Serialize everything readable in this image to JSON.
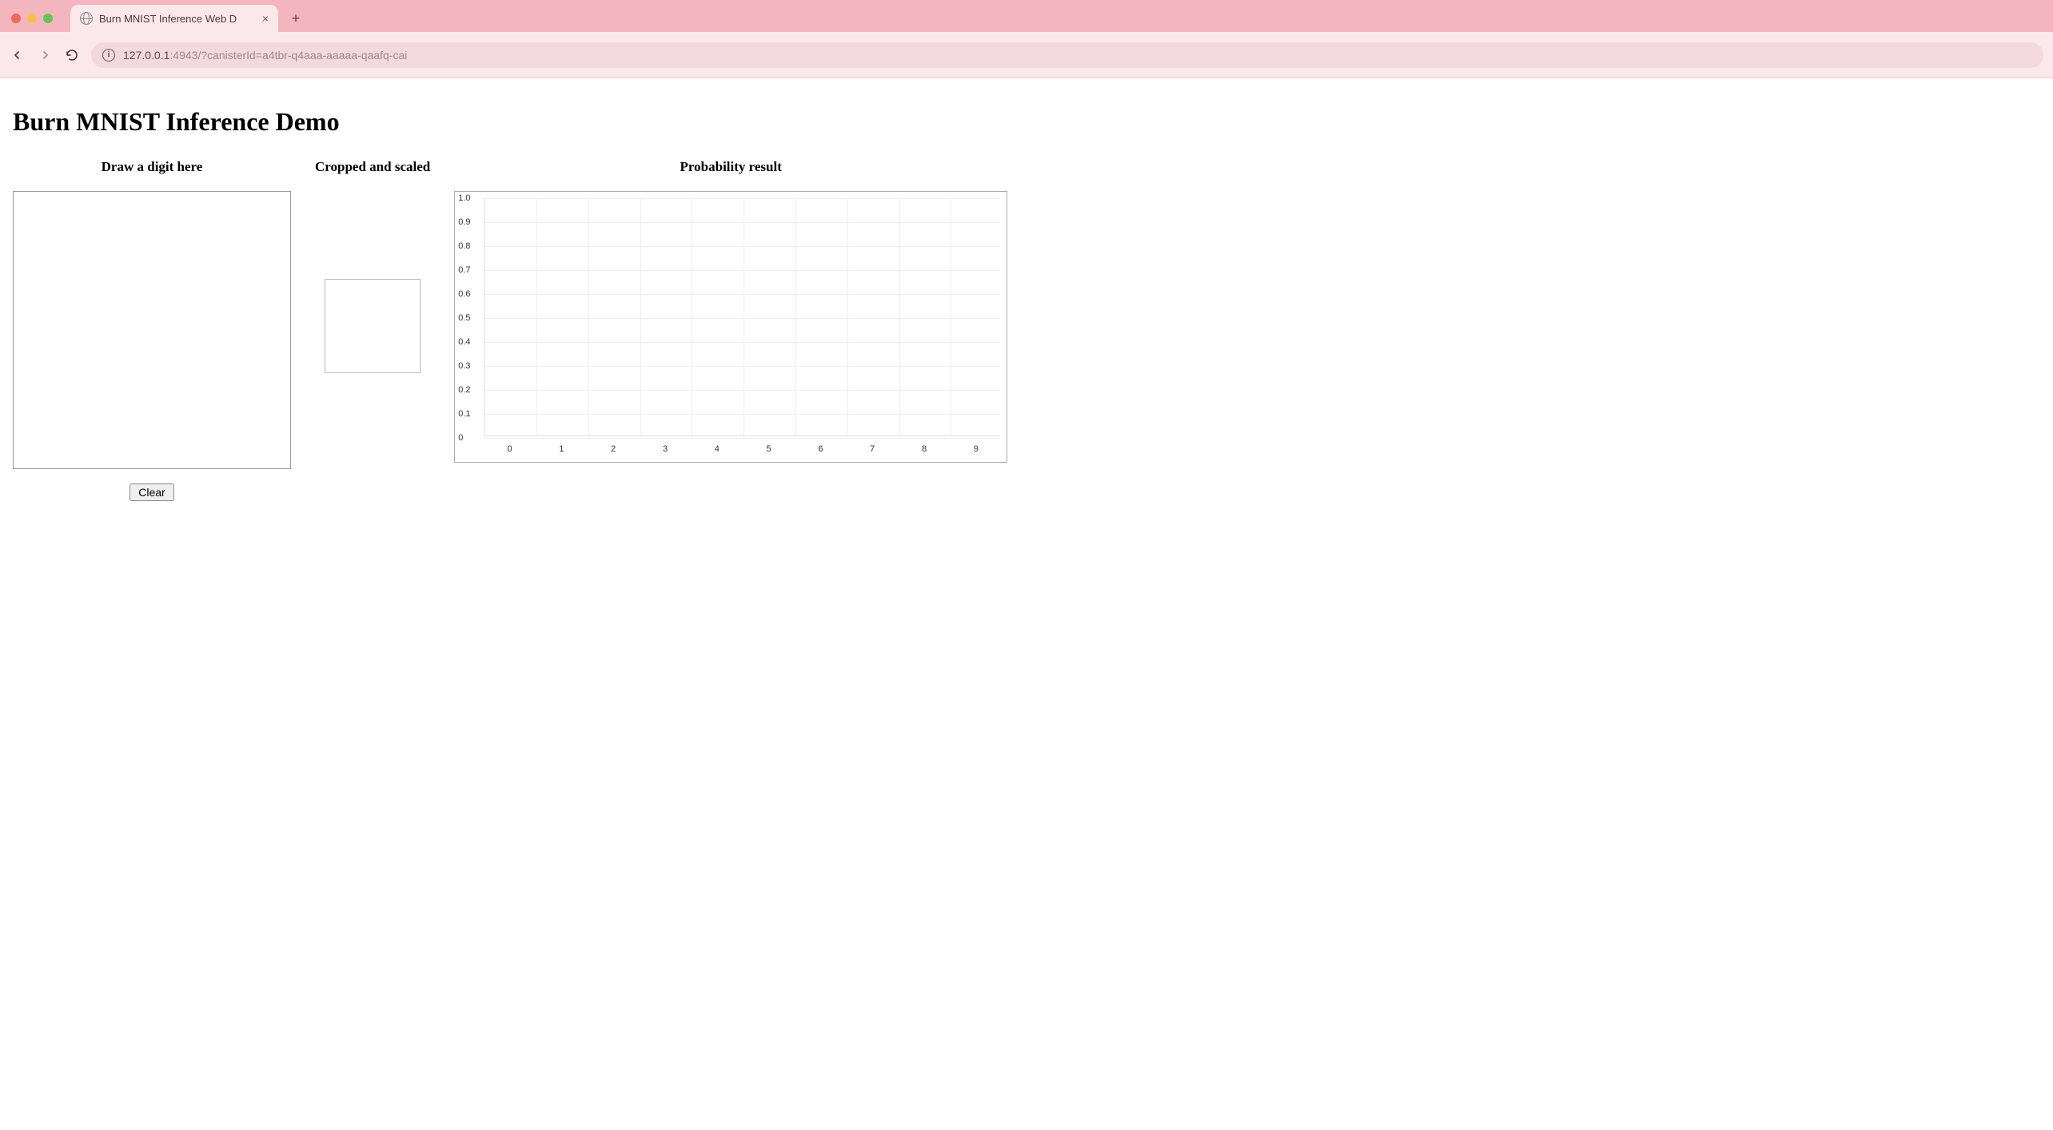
{
  "browser": {
    "tab_title": "Burn MNIST Inference Web D",
    "url_host": "127.0.0.1",
    "url_port": ":4943",
    "url_path": "/?canisterId=a4tbr-q4aaa-aaaaa-qaafq-cai"
  },
  "page": {
    "title": "Burn MNIST Inference Demo",
    "columns": {
      "draw_header": "Draw a digit here",
      "scaled_header": "Cropped and scaled",
      "result_header": "Probability result"
    },
    "clear_button": "Clear"
  },
  "chart_data": {
    "type": "bar",
    "categories": [
      "0",
      "1",
      "2",
      "3",
      "4",
      "5",
      "6",
      "7",
      "8",
      "9"
    ],
    "values": [
      0,
      0,
      0,
      0,
      0,
      0,
      0,
      0,
      0,
      0
    ],
    "title": "",
    "xlabel": "",
    "ylabel": "",
    "ylim": [
      0,
      1.0
    ],
    "yticks": [
      "1.0",
      "0.9",
      "0.8",
      "0.7",
      "0.6",
      "0.5",
      "0.4",
      "0.3",
      "0.2",
      "0.1",
      "0"
    ]
  }
}
